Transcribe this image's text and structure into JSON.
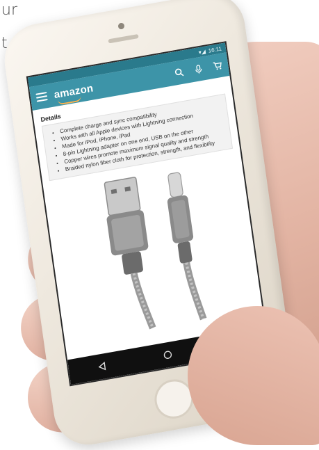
{
  "corner_text": [
    "ur",
    "t"
  ],
  "status_bar": {
    "time": "16:11"
  },
  "app_bar": {
    "logo": "amazon"
  },
  "details": {
    "title": "Details",
    "items": [
      "Complete charge and sync compatibility",
      "Works with all Apple devices with Lightning connection",
      "Made for iPod, iPhone, iPad",
      "8-pin Lightning adapter on one end, USB on the other",
      "Copper wires promote maximum signal quality and strength",
      "Braided nylon fiber cloth for protection, strength, and flexibility"
    ]
  },
  "colors": {
    "app_bar": "#3d94a8",
    "status_bar": "#2a7a8c",
    "nav_bar": "#101010"
  },
  "icons": [
    "menu-icon",
    "search-icon",
    "microphone-icon",
    "cart-icon",
    "back-icon",
    "home-icon",
    "recents-icon"
  ]
}
